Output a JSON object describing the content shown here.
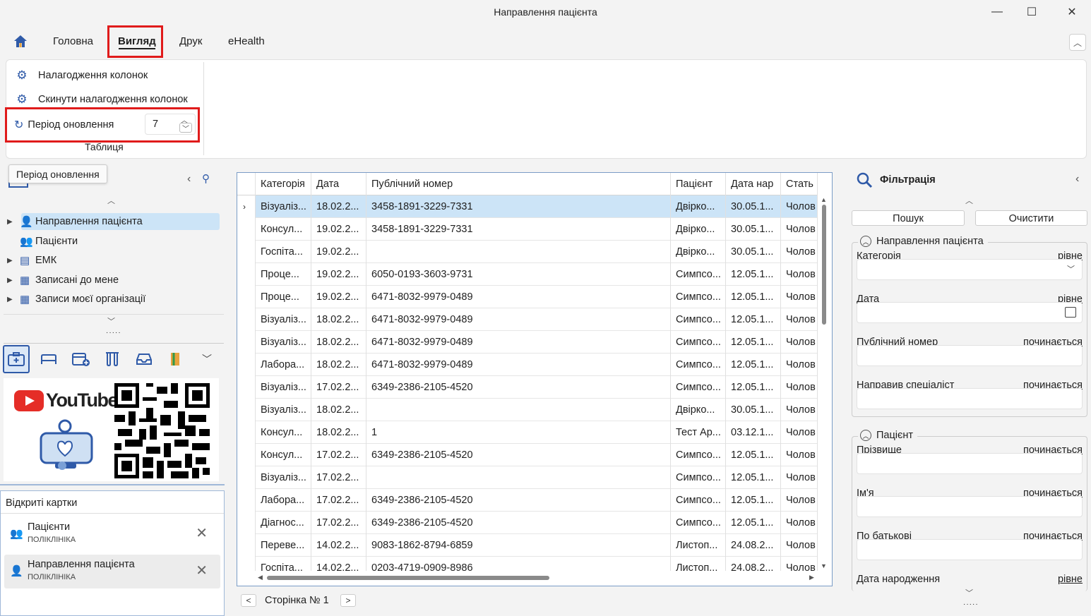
{
  "window": {
    "title": "Направлення пацієнта",
    "min": "—",
    "max": "☐",
    "close": "✕"
  },
  "tabs": {
    "home": "Головна",
    "view": "Вигляд",
    "print": "Друк",
    "ehealth": "eHealth"
  },
  "ribbon": {
    "column_settings": "Налагодження колонок",
    "reset_columns": "Скинути налагодження колонок",
    "refresh_period_label": "Період оновлення",
    "refresh_period_value": "7",
    "group_label": "Таблиця"
  },
  "tooltip": "Період оновлення",
  "tree": [
    {
      "label": "Направлення пацієнта",
      "expand": true
    },
    {
      "label": "Пацієнти",
      "expand": false
    },
    {
      "label": "ЕМК",
      "expand": true
    },
    {
      "label": "Записані до мене",
      "expand": true
    },
    {
      "label": "Записи моєї організації",
      "expand": true
    }
  ],
  "promo": {
    "brand": "YouTube"
  },
  "open_cards": {
    "title": "Відкриті картки",
    "items": [
      {
        "name": "Пацієнти",
        "sub": "ПОЛІКЛІНІКА"
      },
      {
        "name": "Направлення пацієнта",
        "sub": "ПОЛІКЛІНІКА"
      }
    ]
  },
  "grid": {
    "columns": [
      "Категорія",
      "Дата",
      "Публічний номер",
      "Пацієнт",
      "Дата нар",
      "Стать"
    ],
    "rows": [
      [
        "Візуаліз...",
        "18.02.2...",
        "3458-1891-3229-7331",
        "Двірко...",
        "30.05.1...",
        "Чолов"
      ],
      [
        "Консул...",
        "19.02.2...",
        "3458-1891-3229-7331",
        "Двірко...",
        "30.05.1...",
        "Чолов"
      ],
      [
        "Госпіта...",
        "19.02.2...",
        "",
        "Двірко...",
        "30.05.1...",
        "Чолов"
      ],
      [
        "Проце...",
        "19.02.2...",
        "6050-0193-3603-9731",
        "Симпсо...",
        "12.05.1...",
        "Чолов"
      ],
      [
        "Проце...",
        "19.02.2...",
        "6471-8032-9979-0489",
        "Симпсо...",
        "12.05.1...",
        "Чолов"
      ],
      [
        "Візуаліз...",
        "18.02.2...",
        "6471-8032-9979-0489",
        "Симпсо...",
        "12.05.1...",
        "Чолов"
      ],
      [
        "Візуаліз...",
        "18.02.2...",
        "6471-8032-9979-0489",
        "Симпсо...",
        "12.05.1...",
        "Чолов"
      ],
      [
        "Лабора...",
        "18.02.2...",
        "6471-8032-9979-0489",
        "Симпсо...",
        "12.05.1...",
        "Чолов"
      ],
      [
        "Візуаліз...",
        "17.02.2...",
        "6349-2386-2105-4520",
        "Симпсо...",
        "12.05.1...",
        "Чолов"
      ],
      [
        "Візуаліз...",
        "18.02.2...",
        "",
        "Двірко...",
        "30.05.1...",
        "Чолов"
      ],
      [
        "Консул...",
        "18.02.2...",
        "1",
        "Тест Ар...",
        "03.12.1...",
        "Чолов"
      ],
      [
        "Консул...",
        "17.02.2...",
        "6349-2386-2105-4520",
        "Симпсо...",
        "12.05.1...",
        "Чолов"
      ],
      [
        "Візуаліз...",
        "17.02.2...",
        "",
        "Симпсо...",
        "12.05.1...",
        "Чолов"
      ],
      [
        "Лабора...",
        "17.02.2...",
        "6349-2386-2105-4520",
        "Симпсо...",
        "12.05.1...",
        "Чолов"
      ],
      [
        "Діагнос...",
        "17.02.2...",
        "6349-2386-2105-4520",
        "Симпсо...",
        "12.05.1...",
        "Чолов"
      ],
      [
        "Переве...",
        "14.02.2...",
        "9083-1862-8794-6859",
        "Листоп...",
        "24.08.2...",
        "Чолов"
      ],
      [
        "Госпіта...",
        "14.02.2...",
        "0203-4719-0909-8986",
        "Листоп...",
        "24.08.2...",
        "Чолов"
      ]
    ],
    "page_label": "Сторінка № 1",
    "prev": "<",
    "next": ">"
  },
  "filter": {
    "title": "Фільтрація",
    "search": "Пошук",
    "clear": "Очистити",
    "group1": "Направлення пацієнта",
    "group2": "Пацієнт",
    "fields1": [
      {
        "label": "Категорія",
        "mode": "рівне"
      },
      {
        "label": "Дата",
        "mode": "рівне"
      },
      {
        "label": "Публічний номер",
        "mode": "починається"
      },
      {
        "label": "Направив спеціаліст",
        "mode": "починається"
      }
    ],
    "fields2": [
      {
        "label": "Прізвище",
        "mode": "починається"
      },
      {
        "label": "Ім'я",
        "mode": "починається"
      },
      {
        "label": "По батькові",
        "mode": "починається"
      },
      {
        "label": "Дата народження",
        "mode": "рівне"
      }
    ]
  },
  "colors": {
    "accent": "#2f5aa8",
    "highlight": "#e01b1b",
    "selection": "#cce4f7"
  }
}
